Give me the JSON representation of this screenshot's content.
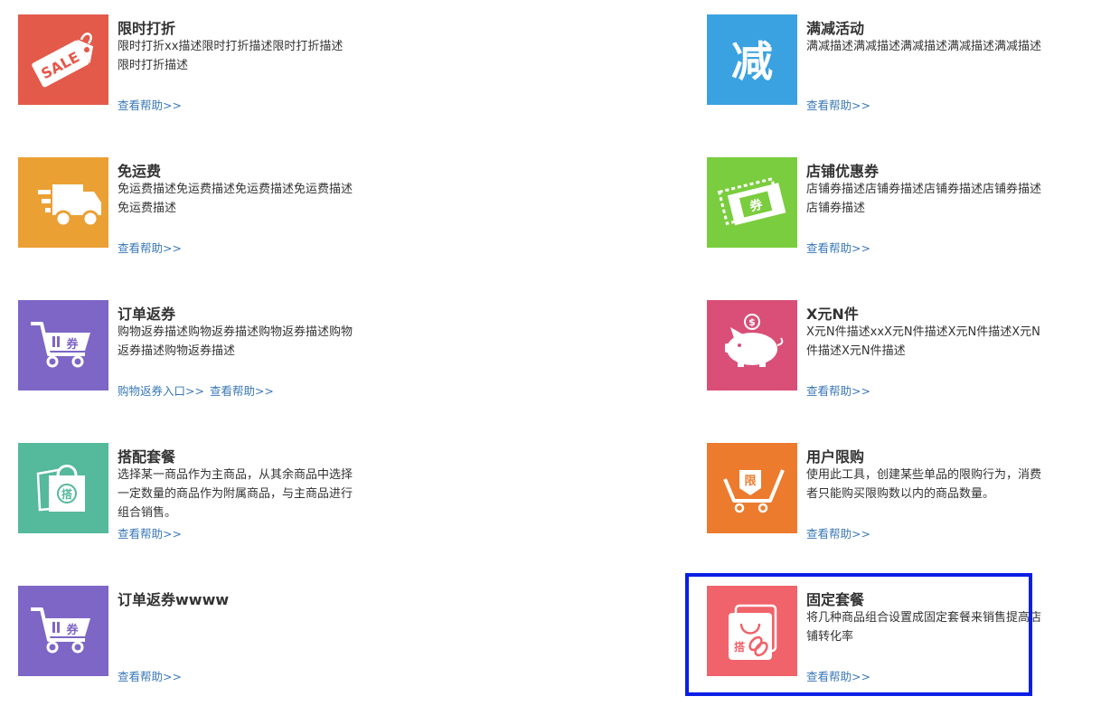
{
  "cards": [
    {
      "title": "限时打折",
      "desc": "限时打折xx描述限时打折描述限时打折描述限时打折描述",
      "links": [
        "查看帮助>>"
      ],
      "color": "#e35a4a",
      "icon": "sale-tag-icon"
    },
    {
      "title": "满减活动",
      "desc": "满减描述满减描述满减描述满减描述满减描述",
      "links": [
        "查看帮助>>"
      ],
      "color": "#3aa2e0",
      "icon": "minus-character-icon",
      "icon_text": "减"
    },
    {
      "title": "免运费",
      "desc": "免运费描述免运费描述免运费描述免运费描述免运费描述",
      "links": [
        "查看帮助>>"
      ],
      "color": "#eba034",
      "icon": "delivery-truck-icon"
    },
    {
      "title": "店铺优惠券",
      "desc": "店铺券描述店铺券描述店铺券描述店铺券描述店铺券描述",
      "links": [
        "查看帮助>>"
      ],
      "color": "#7acd3e",
      "icon": "coupon-ticket-icon",
      "icon_text": "券"
    },
    {
      "title": "订单返券",
      "desc": "购物返券描述购物返券描述购物返券描述购物返券描述购物返券描述",
      "links": [
        "购物返券入口>>",
        "查看帮助>>"
      ],
      "color": "#7d66c5",
      "icon": "cart-coupon-icon",
      "icon_text": "券"
    },
    {
      "title": "X元N件",
      "desc": "X元N件描述xxX元N件描述X元N件描述X元N件描述X元N件描述",
      "links": [
        "查看帮助>>"
      ],
      "color": "#d94f77",
      "icon": "piggy-bank-icon"
    },
    {
      "title": "搭配套餐",
      "desc": "选择某一商品作为主商品，从其余商品中选择一定数量的商品作为附属商品，与主商品进行组合销售。",
      "links": [
        "查看帮助>>"
      ],
      "color": "#55b99c",
      "icon": "shopping-bags-icon",
      "icon_text": "搭"
    },
    {
      "title": "用户限购",
      "desc": "使用此工具，创建某些单品的限购行为，消费者只能购买限购数以内的商品数量。",
      "links": [
        "查看帮助>>"
      ],
      "color": "#ec7b2e",
      "icon": "limit-cart-icon",
      "icon_text": "限"
    },
    {
      "title": "订单返券wwww",
      "desc": "",
      "links": [
        "查看帮助>>"
      ],
      "color": "#7d66c5",
      "icon": "cart-coupon-icon",
      "icon_text": "券"
    },
    {
      "title": "固定套餐",
      "desc": "将几种商品组合设置成固定套餐来销售提高店铺转化率",
      "links": [
        "查看帮助>>"
      ],
      "color": "#f0636a",
      "icon": "package-link-icon",
      "icon_text": "搭"
    }
  ],
  "selection_color": "#0a1ee6",
  "sale_text": "SALE",
  "piggy_symbol": "$"
}
